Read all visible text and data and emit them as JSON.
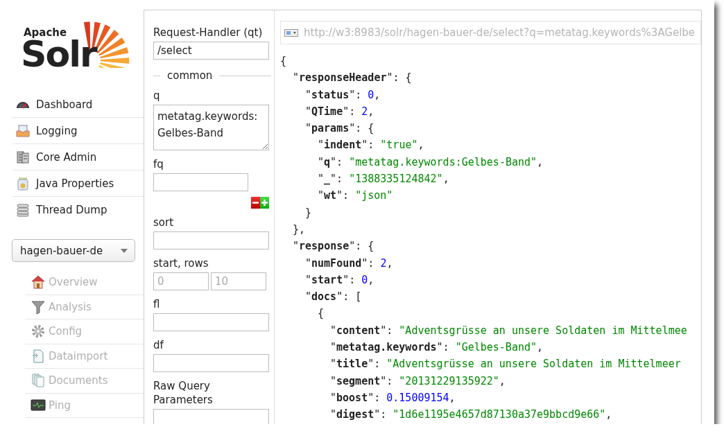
{
  "logo": {
    "small": "Apache",
    "big": "Solr"
  },
  "nav": [
    {
      "label": "Dashboard"
    },
    {
      "label": "Logging"
    },
    {
      "label": "Core Admin"
    },
    {
      "label": "Java Properties"
    },
    {
      "label": "Thread Dump"
    }
  ],
  "core_selector": {
    "value": "hagen-bauer-de"
  },
  "core_nav": [
    {
      "label": "Overview",
      "disabled": true
    },
    {
      "label": "Analysis",
      "disabled": true
    },
    {
      "label": "Config",
      "disabled": true
    },
    {
      "label": "Dataimport",
      "disabled": true
    },
    {
      "label": "Documents",
      "disabled": true
    },
    {
      "label": "Ping",
      "disabled": true
    }
  ],
  "query_form": {
    "handler": {
      "label": "Request-Handler (qt)",
      "value": "/select"
    },
    "section": "common",
    "fields": [
      {
        "kind": "textarea",
        "label": "q",
        "value": "metatag.keywords:Gelbes-Band"
      },
      {
        "kind": "multi",
        "label": "fq"
      },
      {
        "kind": "text",
        "label": "sort"
      },
      {
        "kind": "pair",
        "label": "start, rows",
        "placeholders": [
          "0",
          "10"
        ]
      },
      {
        "kind": "text",
        "label": "fl"
      },
      {
        "kind": "text",
        "label": "df"
      },
      {
        "kind": "text",
        "label": "Raw Query Parameters"
      }
    ]
  },
  "response": {
    "url": "http://w3:8983/solr/hagen-bauer-de/select?q=metatag.keywords%3AGelbe",
    "lines": [
      {
        "text": "{",
        "children": [
          {
            "text": "\"**responseHeader**\": {",
            "children": [
              {
                "text": "\"**status**\": ",
                "value": {
                  "kind": "number",
                  "t": "0"
                },
                "after": ","
              },
              {
                "text": "\"**QTime**\": ",
                "value": {
                  "kind": "number",
                  "t": "2"
                },
                "after": ","
              },
              {
                "text": "\"**params**\": {",
                "children": [
                  {
                    "text": "\"**indent**\": ",
                    "value": {
                      "kind": "string",
                      "t": "\"true\""
                    },
                    "after": ","
                  },
                  {
                    "text": "\"**q**\": ",
                    "value": {
                      "kind": "string",
                      "t": "\"metatag.keywords:Gelbes-Band\""
                    },
                    "after": ","
                  },
                  {
                    "text": "\"**_**\": ",
                    "value": {
                      "kind": "string",
                      "t": "\"1388335124842\""
                    },
                    "after": ","
                  },
                  {
                    "text": "\"**wt**\": ",
                    "value": {
                      "kind": "string",
                      "t": "\"json\""
                    }
                  }
                ]
              },
              {
                "text": "}"
              }
            ]
          },
          {
            "text": "},"
          },
          {
            "text": "\"**response**\": {",
            "children": [
              {
                "text": "\"**numFound**\": ",
                "value": {
                  "kind": "number",
                  "t": "2"
                },
                "after": ","
              },
              {
                "text": "\"**start**\": ",
                "value": {
                  "kind": "number",
                  "t": "0"
                },
                "after": ","
              },
              {
                "text": "\"**docs**\": [",
                "children": [
                  {
                    "text": "{",
                    "children": [
                      {
                        "text": "\"**content**\": ",
                        "value": {
                          "kind": "string",
                          "t": "\"Adventsgrüsse an unsere Soldaten im Mittelmee"
                        }
                      },
                      {
                        "text": "\"**metatag.keywords**\": ",
                        "value": {
                          "kind": "string",
                          "t": "\"Gelbes-Band\""
                        },
                        "after": ","
                      },
                      {
                        "text": "\"**title**\": ",
                        "value": {
                          "kind": "string",
                          "t": "\"Adventsgrüsse an unsere Soldaten im Mittelmeer"
                        }
                      },
                      {
                        "text": "\"**segment**\": ",
                        "value": {
                          "kind": "string",
                          "t": "\"20131229135922\""
                        },
                        "after": ","
                      },
                      {
                        "text": "\"**boost**\": ",
                        "value": {
                          "kind": "number",
                          "t": "0.15009154"
                        },
                        "after": ","
                      },
                      {
                        "text": "\"**digest**\": ",
                        "value": {
                          "kind": "string",
                          "t": "\"1d6e1195e4657d87130a37e9bbcd9e66\""
                        },
                        "after": ","
                      }
                    ]
                  }
                ]
              }
            ]
          }
        ]
      }
    ]
  }
}
